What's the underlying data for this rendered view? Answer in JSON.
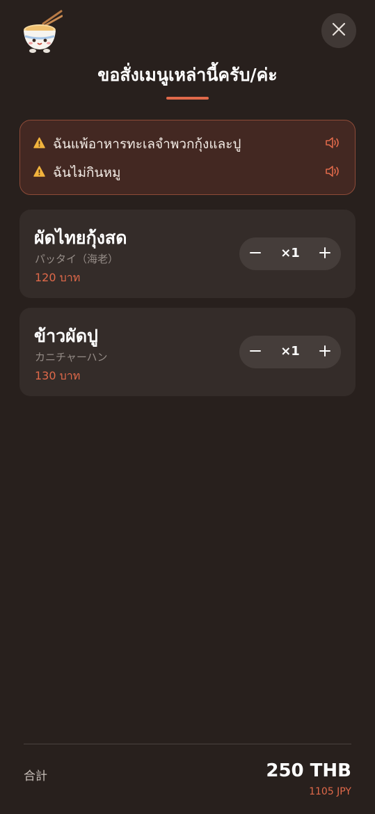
{
  "header": {
    "mascot_icon": "noodle-bowl-mascot-icon",
    "close_icon": "close-icon",
    "title": "ขอสั่งเมนูเหล่านี้ครับ/ค่ะ"
  },
  "allergies": [
    {
      "text": "ฉันแพ้อาหารทะเลจำพวกกุ้งและปู",
      "icon": "warning-icon",
      "audio_icon": "speaker-icon"
    },
    {
      "text": "ฉันไม่กินหมู",
      "icon": "warning-icon",
      "audio_icon": "speaker-icon"
    }
  ],
  "items": [
    {
      "name": "ผัดไทยกุ้งสด",
      "subtitle": "パッタイ（海老）",
      "price": "120 บาท",
      "quantity": "×1"
    },
    {
      "name": "ข้าวผัดปู",
      "subtitle": "カニチャーハン",
      "price": "130 บาท",
      "quantity": "×1"
    }
  ],
  "footer": {
    "total_label": "合計",
    "total_thb": "250 THB",
    "total_jpy": "1105 JPY"
  },
  "colors": {
    "background": "#28201d",
    "card": "#342c29",
    "accent": "#e0694a",
    "warning": "#f2b33d",
    "allergy_box": "#432822"
  }
}
